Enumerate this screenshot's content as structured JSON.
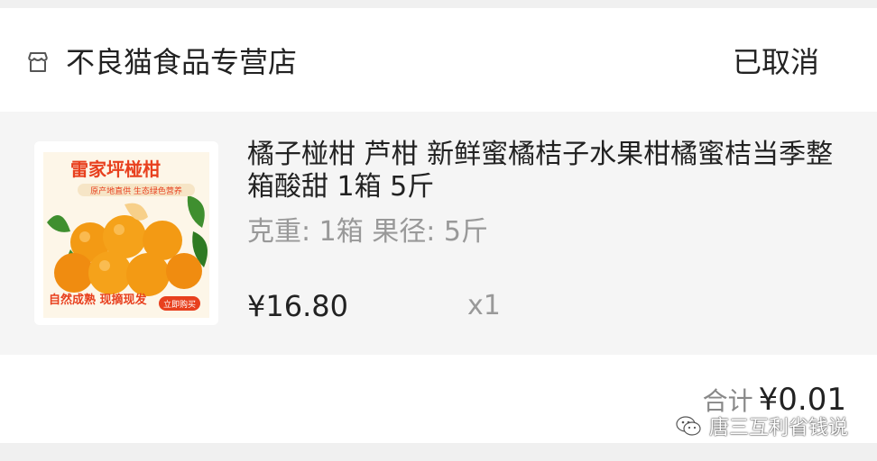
{
  "store": {
    "name": "不良猫食品专营店",
    "icon": "store-icon"
  },
  "order": {
    "status": "已取消"
  },
  "item": {
    "image_label": "product-image",
    "image_text": {
      "headline": "雷家坪椪柑",
      "tagline": "原产地直供  生态绿色营养",
      "slogan": "自然成熟  现摘现发",
      "cta": "立即购买"
    },
    "title": "橘子椪柑 芦柑 新鲜蜜橘桔子水果柑橘蜜桔当季整箱酸甜 1箱 5斤",
    "spec": "克重: 1箱 果径: 5斤",
    "price": "¥16.80",
    "quantity": "x1"
  },
  "summary": {
    "total_label": "合计",
    "total_amount": "¥0.01"
  },
  "watermark": {
    "text": "唐三互利省钱说",
    "icon": "wechat-icon"
  },
  "colors": {
    "background": "#f4f4f4",
    "card": "#ffffff",
    "item_bg": "#f5f5f5",
    "muted_text": "#999999",
    "orange": "#f39c12"
  }
}
